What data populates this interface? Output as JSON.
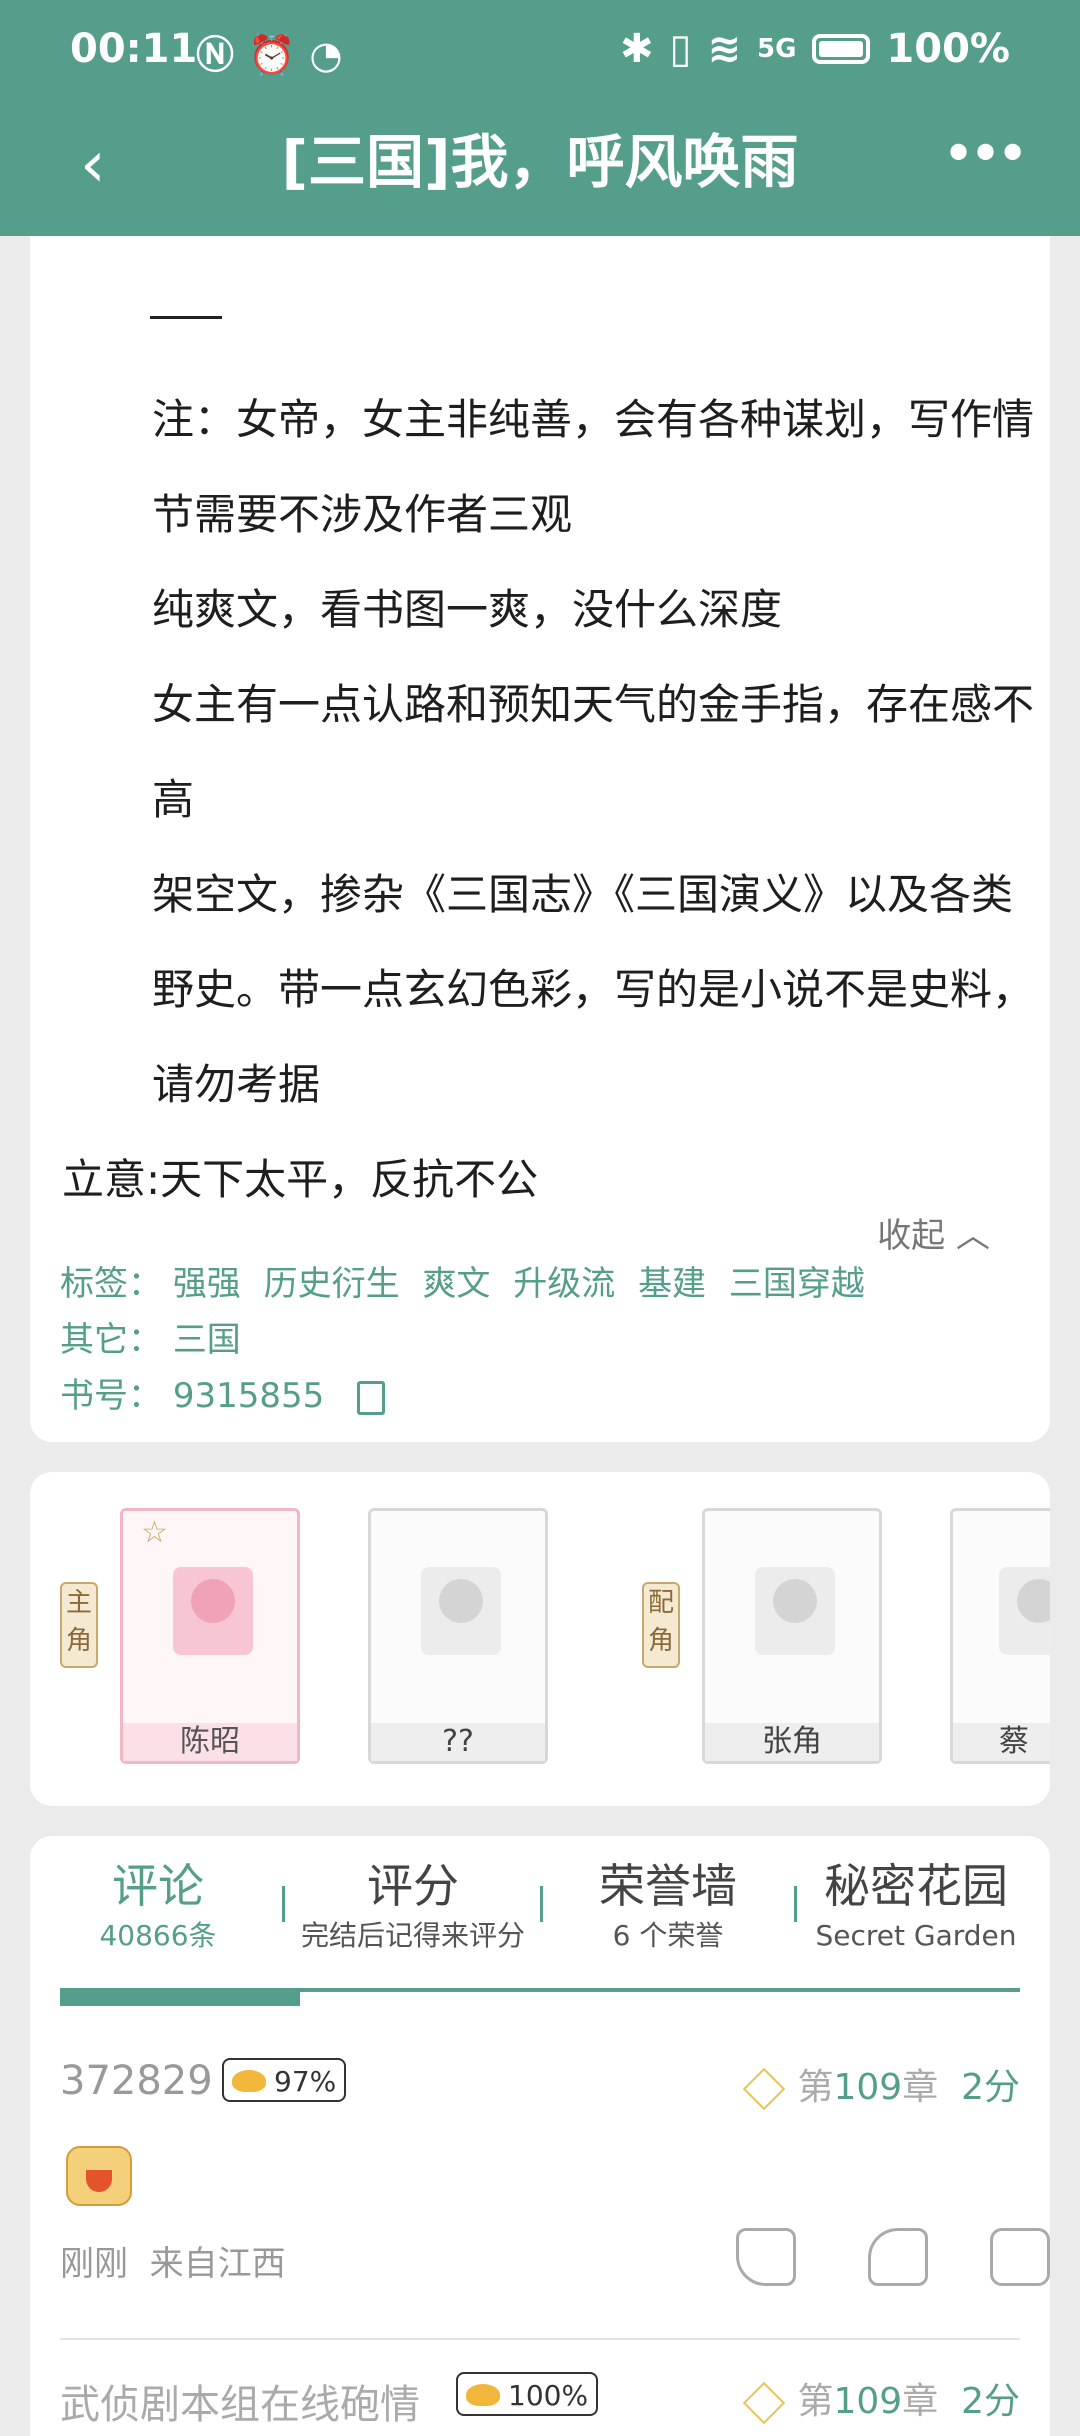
{
  "status_bar": {
    "time": "00:11",
    "left_icons": [
      "nfc-icon",
      "alarm-icon",
      "wifi-question-icon"
    ],
    "right_icons": [
      "bluetooth-icon",
      "vibrate-icon",
      "wifi-icon",
      "5g-signal-icon",
      "battery-icon"
    ],
    "network": "5G",
    "battery": "100%"
  },
  "header": {
    "title": "[三国]我，呼风唤雨",
    "back_icon": "‹",
    "more_icon": "•••"
  },
  "intro": {
    "paragraphs": [
      {
        "text": "注：女帝，女主非纯善，会有各种谋划，写作情节需要不涉及作者三观",
        "indent": true
      },
      {
        "text": "纯爽文，看书图一爽，没什么深度",
        "indent": true
      },
      {
        "text": "女主有一点认路和预知天气的金手指，存在感不高",
        "indent": true
      },
      {
        "text": "架空文，掺杂《三国志》《三国演义》以及各类野史。带一点玄幻色彩，写的是小说不是史料，请勿考据",
        "indent": true
      },
      {
        "text": "立意:天下太平，反抗不公",
        "indent": false
      }
    ],
    "collapse_label": "收起",
    "tags_label": "标签：",
    "tags": [
      "强强",
      "历史衍生",
      "爽文",
      "升级流",
      "基建",
      "三国穿越"
    ],
    "other_label": "其它：",
    "other_value": "三国",
    "book_no_label": "书号：",
    "book_no": "9315855"
  },
  "characters": {
    "main_label": "主角",
    "support_label": "配角",
    "items": [
      {
        "name": "陈昭",
        "role": "main"
      },
      {
        "name": "??",
        "role": "main"
      },
      {
        "name": "张角",
        "role": "support"
      },
      {
        "name": "蔡",
        "role": "support"
      }
    ]
  },
  "tabs": [
    {
      "label": "评论",
      "sub": "40866条",
      "active": true
    },
    {
      "label": "评分",
      "sub": "完结后记得来评分",
      "active": false
    },
    {
      "label": "荣誉墙",
      "sub": "6 个荣誉",
      "active": false
    },
    {
      "label": "秘密花园",
      "sub": "Secret Garden",
      "active": false
    }
  ],
  "comments": [
    {
      "user": "372829",
      "badge": "97%",
      "chapter_prefix": "第",
      "chapter": "109",
      "chapter_suffix": "章",
      "score": "2分",
      "time": "刚刚",
      "location": "来自江西"
    },
    {
      "user": "武侦剧本组在线砲情",
      "badge": "100%",
      "chapter_prefix": "第",
      "chapter": "109",
      "chapter_suffix": "章",
      "score": "2分"
    }
  ],
  "colors": {
    "accent": "#559e8c",
    "background": "#ebebeb"
  }
}
